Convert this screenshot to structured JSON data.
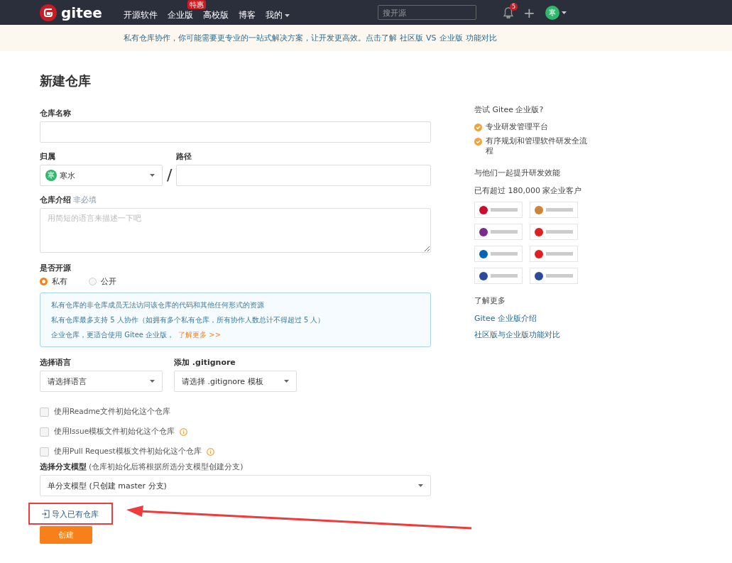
{
  "navbar": {
    "logo_text": "gitee",
    "links": [
      {
        "label": "开源软件"
      },
      {
        "label": "企业版",
        "badge": "特惠"
      },
      {
        "label": "高校版"
      },
      {
        "label": "博客"
      },
      {
        "label": "我的",
        "dropdown": true
      }
    ],
    "search": {
      "placeholder": "搜开源"
    },
    "notification_count": "5",
    "plus": "+",
    "avatar_text": "寒"
  },
  "banner": {
    "text": "私有仓库协作，你可能需要更专业的一站式解决方案，让开发更高效。点击了解",
    "links": [
      "社区版",
      "VS",
      "企业版",
      "功能对比"
    ]
  },
  "form": {
    "title": "新建仓库",
    "repo_name": {
      "label": "仓库名称"
    },
    "owner": {
      "label": "归属",
      "value": "寒水",
      "avatar_text": "寒"
    },
    "separator": "/",
    "path": {
      "label": "路径"
    },
    "description": {
      "label": "仓库介绍",
      "hint": "非必填",
      "placeholder": "用简短的语言来描述一下吧"
    },
    "visibility": {
      "label": "是否开源",
      "options": [
        {
          "label": "私有",
          "selected": true
        },
        {
          "label": "公开",
          "selected": false
        }
      ]
    },
    "notice": {
      "lines": [
        "私有仓库的非仓库成员无法访问该仓库的代码和其他任何形式的资源",
        "私有仓库最多支持 5 人协作（如拥有多个私有仓库，所有协作人数总计不得超过 5 人）",
        "企业仓库，更适合使用 Gitee 企业版，"
      ],
      "link": "了解更多 >>"
    },
    "language": {
      "label": "选择语言",
      "value": "请选择语言"
    },
    "gitignore": {
      "label": "添加 .gitignore",
      "value": "请选择 .gitignore 模板"
    },
    "options": [
      {
        "label": "使用Readme文件初始化这个仓库",
        "checked": false,
        "info": false
      },
      {
        "label": "使用Issue模板文件初始化这个仓库",
        "checked": false,
        "info": true
      },
      {
        "label": "使用Pull Request模板文件初始化这个仓库",
        "checked": false,
        "info": true
      }
    ],
    "branch_model": {
      "label": "选择分支模型",
      "hint": "(仓库初始化后将根据所选分支模型创建分支)",
      "value": "单分支模型 (只创建 master 分支)"
    },
    "import_link": "导入已有仓库",
    "submit": "创建"
  },
  "sidebar": {
    "title": "尝试 Gitee 企业版?",
    "features": [
      "专业研发管理平台",
      "有序规划和管理软件研发全流程"
    ],
    "heading": "与他们一起提升研发效能",
    "customers": "已有超过 180,000 家企业客户",
    "logos": [
      {
        "color": "#c8102e"
      },
      {
        "color": "#c9853a"
      },
      {
        "color": "#7b2a8c"
      },
      {
        "color": "#e02020"
      },
      {
        "color": "#0066b3"
      },
      {
        "color": "#e02020"
      },
      {
        "color": "#2a4b9a"
      },
      {
        "color": "#2a4b9a"
      }
    ],
    "more_title": "了解更多",
    "links": [
      "Gitee 企业版介绍",
      "社区版与企业版功能对比"
    ]
  }
}
